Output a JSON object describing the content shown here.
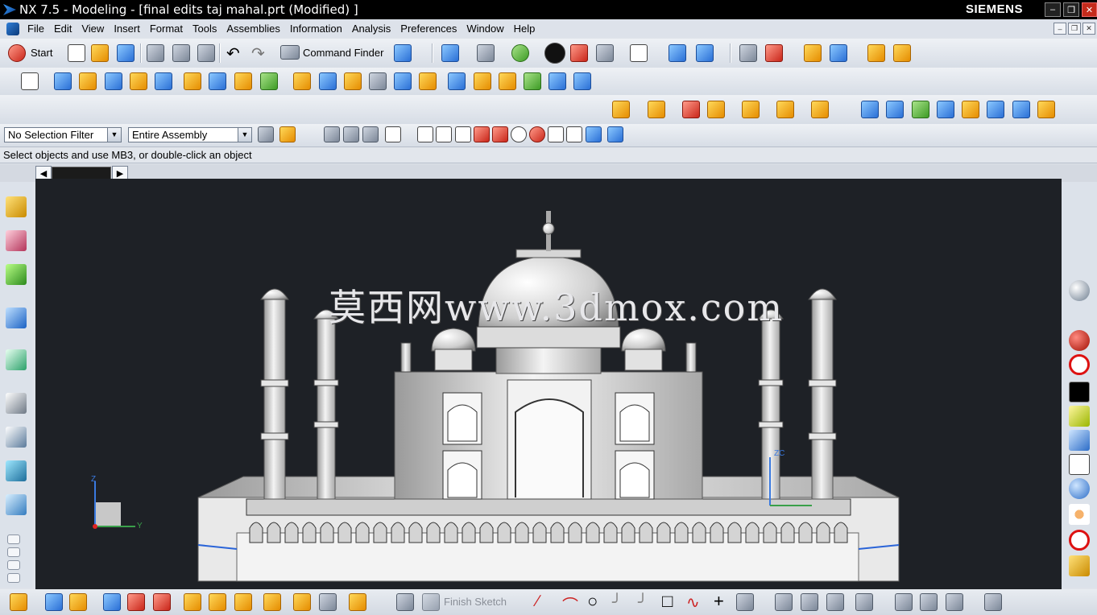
{
  "window": {
    "title": "NX 7.5 - Modeling - [final edits taj mahal.prt (Modified) ]",
    "brand": "SIEMENS"
  },
  "menu": [
    "File",
    "Edit",
    "View",
    "Insert",
    "Format",
    "Tools",
    "Assemblies",
    "Information",
    "Analysis",
    "Preferences",
    "Window",
    "Help"
  ],
  "toolbar": {
    "start_label": "Start",
    "command_finder_label": "Command Finder"
  },
  "selection": {
    "filter": "No Selection Filter",
    "scope": "Entire Assembly"
  },
  "cue_line": "Select objects and use MB3, or double-click an object",
  "watermark": "莫西网www.3dmox.com",
  "triad": {
    "z": "Z",
    "y": "Y",
    "zc": "ZC"
  },
  "bottom": {
    "finish_sketch": "Finish Sketch"
  },
  "colors": {
    "viewport": "#1e2126",
    "titlebar": "#000000"
  }
}
